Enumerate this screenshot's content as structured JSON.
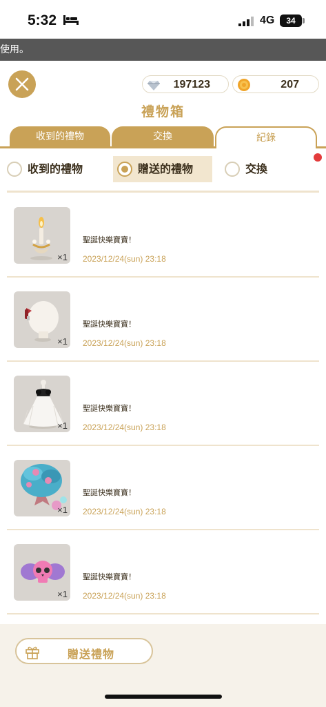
{
  "status_bar": {
    "time": "5:32",
    "network": "4G",
    "battery": "34"
  },
  "notice": {
    "text": "使用。"
  },
  "currency": {
    "diamonds": "197123",
    "coins": "207"
  },
  "title": "禮物箱",
  "tabs": [
    {
      "label": "收到的禮物"
    },
    {
      "label": "交換"
    },
    {
      "label": "紀錄"
    }
  ],
  "filters": [
    {
      "label": "收到的禮物",
      "selected": false
    },
    {
      "label": "贈送的禮物",
      "selected": true
    },
    {
      "label": "交換",
      "selected": false
    }
  ],
  "records": [
    {
      "item_icon": "candle-item-icon",
      "qty": "×1",
      "message": "聖誕快樂寶寶！",
      "date": "2023/12/24(sun) 23:18"
    },
    {
      "item_icon": "hair-bow-item-icon",
      "qty": "×1",
      "message": "聖誕快樂寶寶！",
      "date": "2023/12/24(sun) 23:18"
    },
    {
      "item_icon": "lace-dress-item-icon",
      "qty": "×1",
      "message": "聖誕快樂寶寶！",
      "date": "2023/12/24(sun) 23:18"
    },
    {
      "item_icon": "blue-tree-item-icon",
      "qty": "×1",
      "message": "聖誕快樂寶寶！",
      "date": "2023/12/24(sun) 23:18"
    },
    {
      "item_icon": "skull-bow-item-icon",
      "qty": "×1",
      "message": "聖誕快樂寶寶！",
      "date": "2023/12/24(sun) 23:18"
    }
  ],
  "footer": {
    "gift_button_label": "贈送禮物"
  },
  "colors": {
    "gold": "#c9a257",
    "cream": "#f2e6cf",
    "notice_bg": "#575757",
    "alert_dot": "#e33b3b"
  }
}
